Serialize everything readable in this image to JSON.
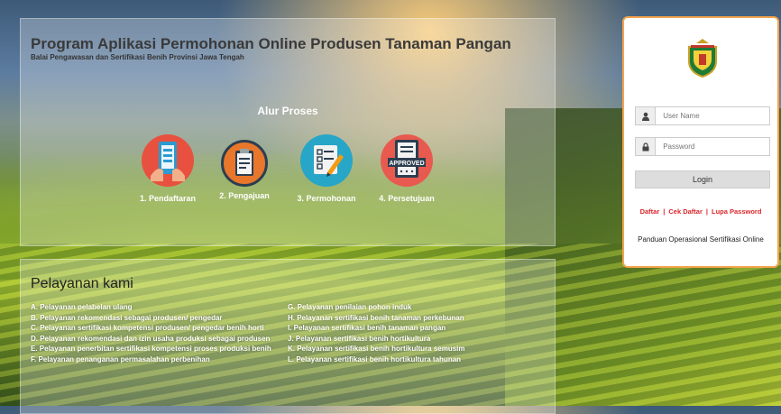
{
  "header": {
    "title": "Program Aplikasi Permohonan Online Produsen Tanaman Pangan",
    "subtitle": "Balai Pengawasan dan Sertifikasi Benih Provinsi Jawa Tengah"
  },
  "process": {
    "heading": "Alur Proses",
    "steps": [
      {
        "label": "1. Pendaftaran",
        "icon": "tablet-icon",
        "color": "#e8513f"
      },
      {
        "label": "2. Pengajuan",
        "icon": "clipboard-icon",
        "color": "#e8772b"
      },
      {
        "label": "3. Permohonan",
        "icon": "checklist-pen-icon",
        "color": "#27a6c8"
      },
      {
        "label": "4. Persetujuan",
        "icon": "approved-document-icon",
        "color": "#e85a4f"
      }
    ]
  },
  "services": {
    "heading": "Pelayanan kami",
    "left": [
      "A. Pelayanan pelabelan ulang",
      "B. Pelayanan rekomendasi sebagai produsen/ pengedar",
      "C. Pelayanan sertifikasi kompetensi produsen/ pengedar benih horti",
      "D. Pelayanan rekomendasi dan izin usaha produksi sebagai produsen",
      "E. Pelayanan penerbitan sertifikasi kompetensi proses produksi benih",
      "F. Pelayanan penanganan permasalahan perbenihan"
    ],
    "right": [
      "G. Pelayanan penilaian pohon induk",
      "H. Pelayanan sertifikasi benih tanaman perkebunan",
      "I. Pelayanan sertifikasi benih tanaman pangan",
      "J. Pelayanan sertifikasi benih hortikultura",
      "K. Pelayanan sertifikasi benih hortikultura semusim",
      "L. Pelayanan sertifikasi benih hortikultura tahunan"
    ]
  },
  "login": {
    "username_placeholder": "User Name",
    "password_placeholder": "Password",
    "login_label": "Login",
    "links": [
      "Daftar",
      "Cek Daftar",
      "Lupa Password"
    ],
    "guide": "Panduan Operasional Sertifikasi Online",
    "accent": "#f4a34c",
    "link_color": "#d9262b"
  }
}
